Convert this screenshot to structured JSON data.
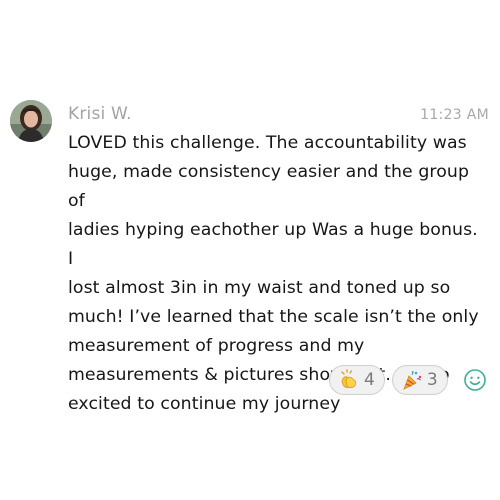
{
  "message": {
    "author": "Krisi W.",
    "timestamp": "11:23 AM",
    "body": "LOVED this challenge. The accountability was\nhuge, made consistency easier and the group of\nladies hyping eachother up Was a huge bonus. I\nlost almost 3in in my waist and toned up so\nmuch!  I’ve learned that the scale isn’t the only\nmeasurement of progress and my\nmeasurements & pictures show that. I’m so\nexcited to continue my journey",
    "avatar_icon": "user-photo-avatar"
  },
  "reactions": [
    {
      "icon": "clapping-hands-icon",
      "count": "4"
    },
    {
      "icon": "party-popper-icon",
      "count": "3"
    }
  ],
  "add_reaction": {
    "icon": "smiley-face-icon"
  },
  "colors": {
    "author": "#a3a3a3",
    "timestamp": "#a8a8a8",
    "body_text": "#161616",
    "pill_border": "#cfcfcf",
    "pill_background": "#f1f1f1",
    "add_reaction_accent": "#3fae94"
  }
}
